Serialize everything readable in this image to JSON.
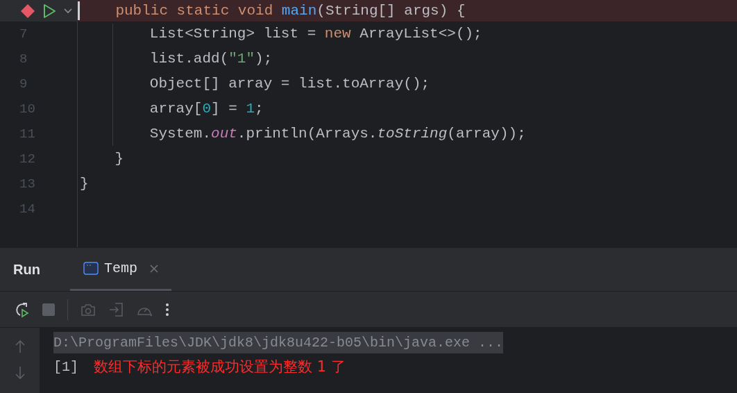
{
  "editor": {
    "current_line": {
      "breakpoint": true,
      "tokens": [
        {
          "kind": "keyword",
          "text": "    public static void "
        },
        {
          "kind": "declaration",
          "text": "main"
        },
        {
          "kind": "plain",
          "text": "(String[] args) {"
        }
      ]
    },
    "lines": [
      {
        "number": "7",
        "tokens": [
          {
            "kind": "plain",
            "text": "        List<String> list = "
          },
          {
            "kind": "keyword",
            "text": "new "
          },
          {
            "kind": "plain",
            "text": "ArrayList<>();"
          }
        ]
      },
      {
        "number": "8",
        "tokens": [
          {
            "kind": "plain",
            "text": "        list.add("
          },
          {
            "kind": "string",
            "text": "\"1\""
          },
          {
            "kind": "plain",
            "text": ");"
          }
        ]
      },
      {
        "number": "9",
        "tokens": [
          {
            "kind": "plain",
            "text": "        Object[] array = list.toArray();"
          }
        ]
      },
      {
        "number": "10",
        "tokens": [
          {
            "kind": "plain",
            "text": "        array["
          },
          {
            "kind": "number",
            "text": "0"
          },
          {
            "kind": "plain",
            "text": "] = "
          },
          {
            "kind": "number",
            "text": "1"
          },
          {
            "kind": "plain",
            "text": ";"
          }
        ]
      },
      {
        "number": "11",
        "tokens": [
          {
            "kind": "plain",
            "text": "        System."
          },
          {
            "kind": "field",
            "text": "out"
          },
          {
            "kind": "plain",
            "text": ".println(Arrays."
          },
          {
            "kind": "static",
            "text": "toString"
          },
          {
            "kind": "plain",
            "text": "(array));"
          }
        ]
      },
      {
        "number": "12",
        "tokens": [
          {
            "kind": "plain",
            "text": "    }"
          }
        ]
      },
      {
        "number": "13",
        "tokens": [
          {
            "kind": "plain",
            "text": "}"
          }
        ]
      },
      {
        "number": "14"
      }
    ]
  },
  "run_panel": {
    "title": "Run",
    "tabs": [
      {
        "label": "Temp",
        "selected": true
      }
    ],
    "console": [
      {
        "kind": "command",
        "text": "D:\\ProgramFiles\\JDK\\jdk8\\jdk8u422-b05\\bin\\java.exe ..."
      },
      {
        "kind": "output",
        "text": "[1]",
        "note": "数组下标的元素被成功设置为整数 1 了"
      }
    ]
  }
}
